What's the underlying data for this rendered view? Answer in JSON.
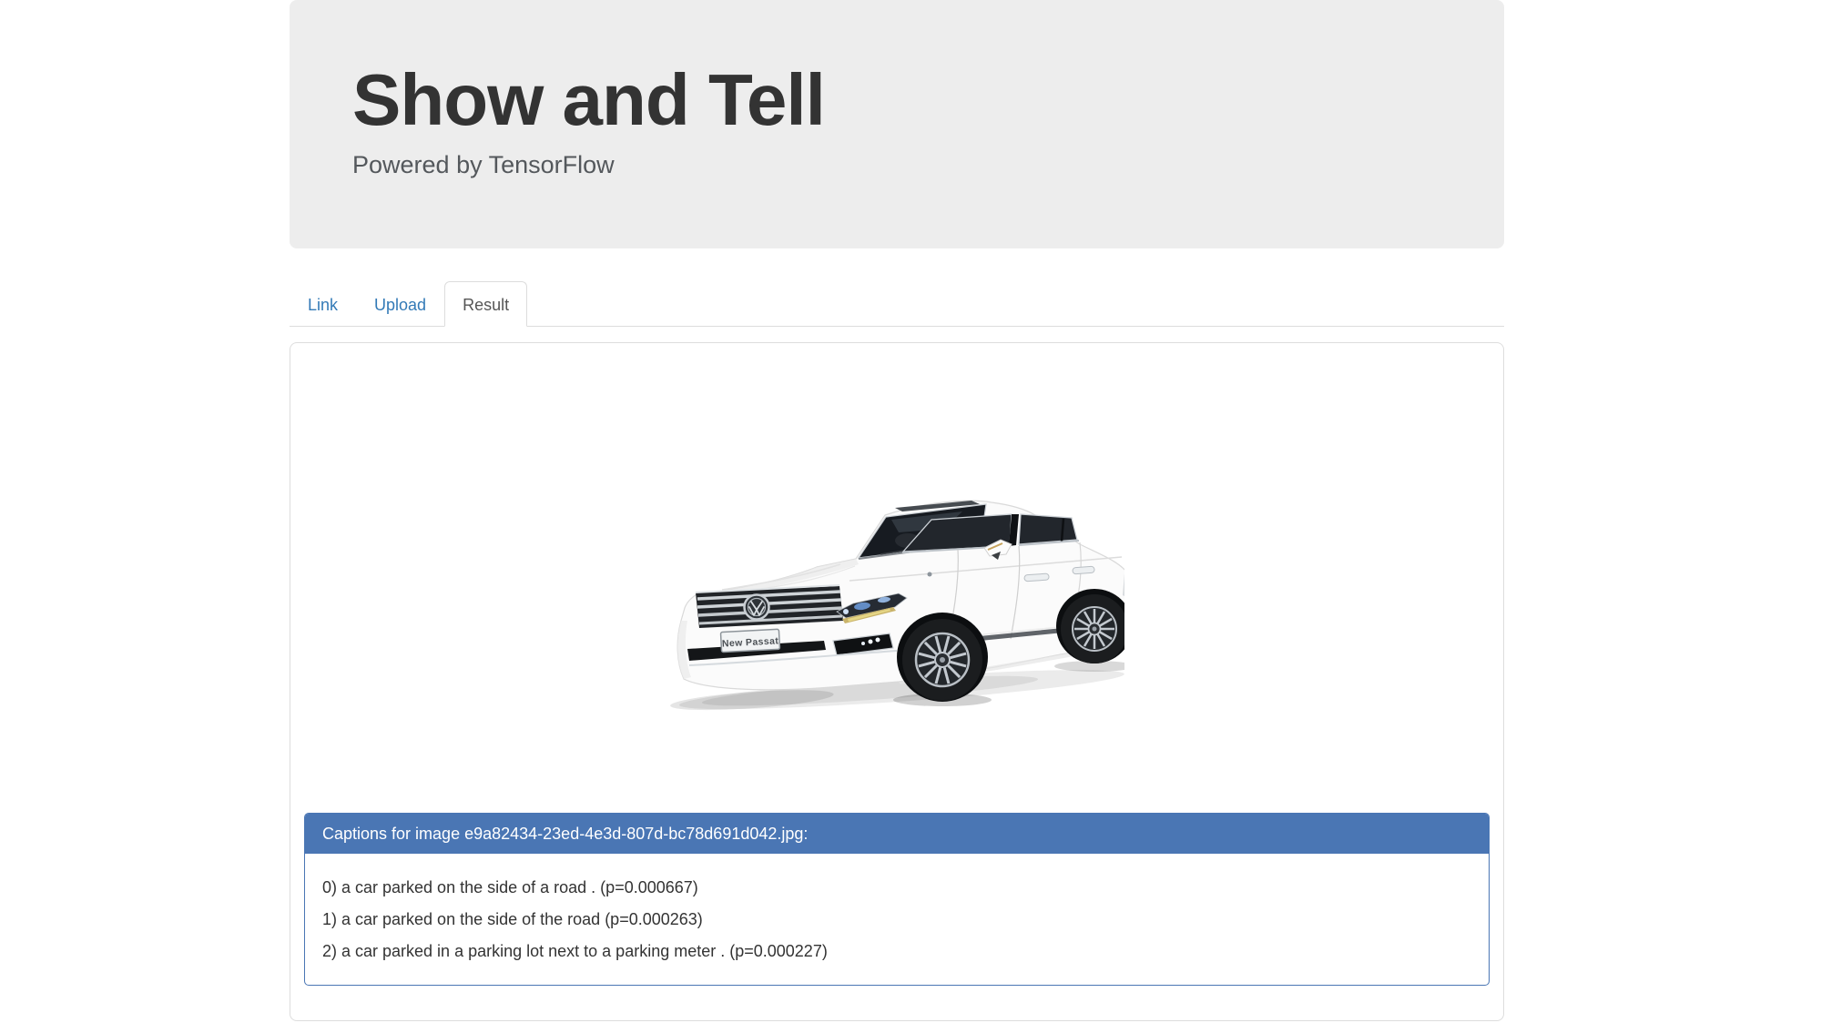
{
  "header": {
    "title": "Show and Tell",
    "subtitle": "Powered by TensorFlow"
  },
  "tabs": {
    "items": [
      {
        "label": "Link",
        "active": false
      },
      {
        "label": "Upload",
        "active": false
      },
      {
        "label": "Result",
        "active": true
      }
    ]
  },
  "result": {
    "image_alt": "White Volkswagen New Passat sedan, front three-quarter view on white background",
    "plate_text": "New Passat",
    "captions_panel": {
      "heading": "Captions for image e9a82434-23ed-4e3d-807d-bc78d691d042.jpg:",
      "captions": [
        "0) a car parked on the side of a road . (p=0.000667)",
        "1) a car parked on the side of the road (p=0.000263)",
        "2) a car parked in a parking lot next to a parking meter . (p=0.000227)"
      ]
    }
  },
  "colors": {
    "panel_blue": "#4a76b4",
    "link_blue": "#337ab7",
    "jumbotron_bg": "#ededed",
    "tab_border": "#dddddd"
  }
}
